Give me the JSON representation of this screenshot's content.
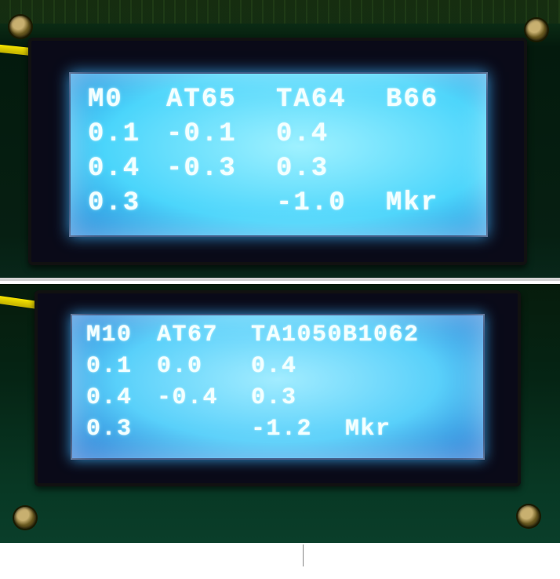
{
  "display1": {
    "row0": {
      "c0": "M0",
      "c1": "AT65",
      "c2": "TA64",
      "c3": "B66"
    },
    "row1": {
      "c0": "0.1",
      "c1": "-0.1",
      "c2": "0.4",
      "c3": ""
    },
    "row2": {
      "c0": "0.4",
      "c1": "-0.3",
      "c2": "0.3",
      "c3": ""
    },
    "row3": {
      "c0": "0.3",
      "c1": "",
      "c2": "-1.0",
      "c3": "Mkr"
    }
  },
  "display2": {
    "row0": {
      "c0": "M10",
      "c1": "AT67",
      "c2": "TA1050B1062",
      "c3": ""
    },
    "row1": {
      "c0": "0.1",
      "c1": "0.0",
      "c2": "0.4",
      "c3": ""
    },
    "row2": {
      "c0": "0.4",
      "c1": "-0.4",
      "c2": "0.3",
      "c3": ""
    },
    "row3": {
      "c0": "0.3",
      "c1": "",
      "c2": "-1.2",
      "c3": "Mkr"
    }
  }
}
